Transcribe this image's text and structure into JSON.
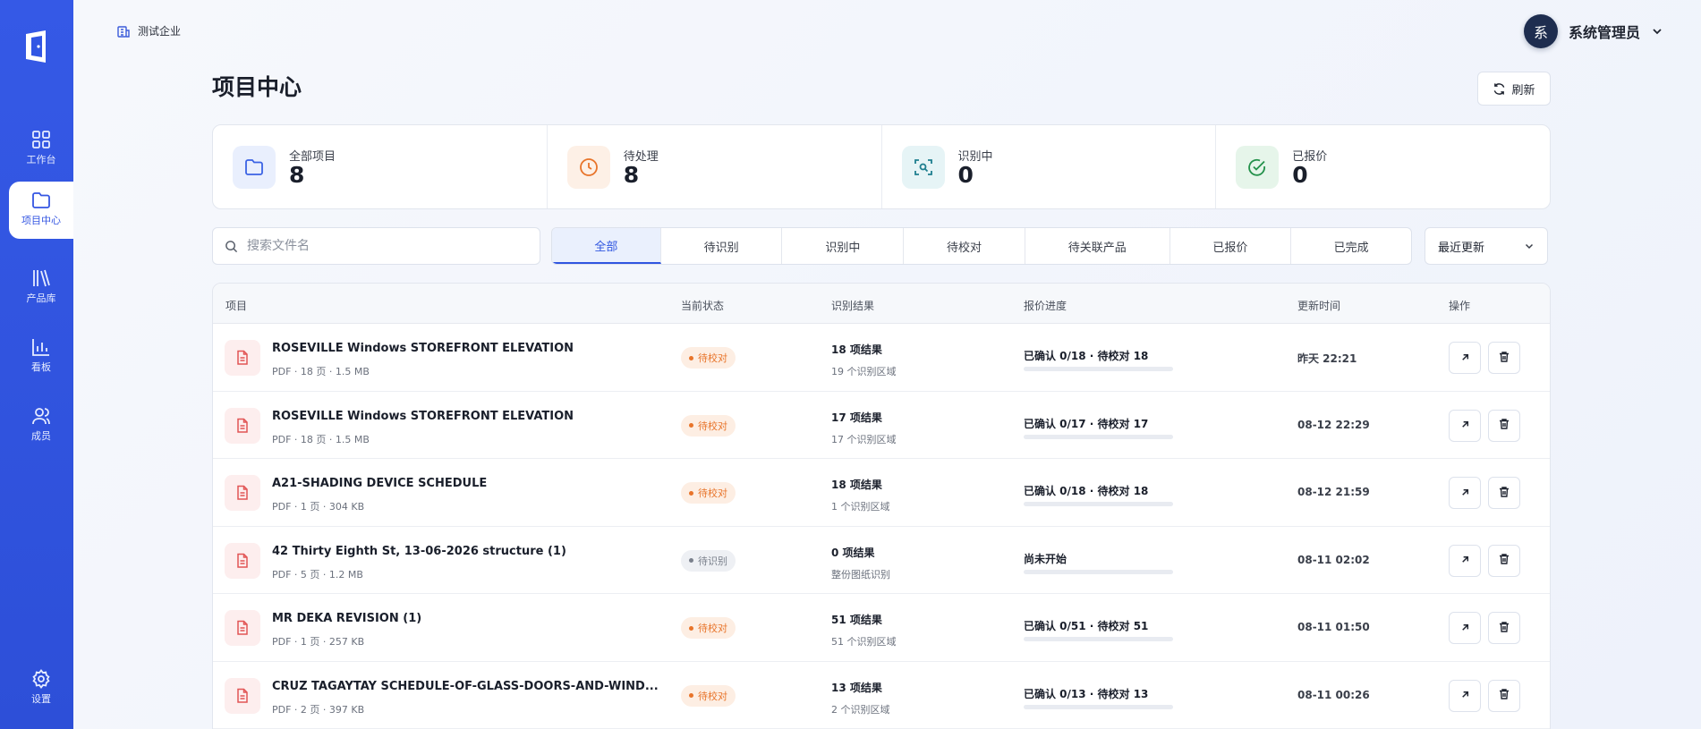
{
  "colors": {
    "sidebar": "#3156e4",
    "accent": "#2f55e0",
    "pending_review": "#e8742a",
    "pending_recognize": "#7a808c"
  },
  "sidebar": {
    "logo": "door-logo-icon",
    "items": [
      {
        "label": "工作台",
        "icon": "grid-icon"
      },
      {
        "label": "项目中心",
        "icon": "folder-icon",
        "active": true
      },
      {
        "label": "产品库",
        "icon": "books-icon"
      },
      {
        "label": "看板",
        "icon": "chart-icon"
      },
      {
        "label": "成员",
        "icon": "users-icon"
      },
      {
        "label": "设置",
        "icon": "gear-icon"
      }
    ]
  },
  "header": {
    "company": "测试企业",
    "user_avatar": "系",
    "user_name": "系统管理员"
  },
  "page": {
    "title": "项目中心",
    "refresh_label": "刷新"
  },
  "stats": [
    {
      "label": "全部项目",
      "value": "8"
    },
    {
      "label": "待处理",
      "value": "8"
    },
    {
      "label": "识别中",
      "value": "0"
    },
    {
      "label": "已报价",
      "value": "0"
    }
  ],
  "search": {
    "placeholder": "搜索文件名",
    "value": ""
  },
  "tabs": [
    "全部",
    "待识别",
    "识别中",
    "待校对",
    "待关联产品",
    "已报价",
    "已完成"
  ],
  "active_tab": "全部",
  "sort": {
    "selected": "最近更新"
  },
  "table": {
    "headers": {
      "project": "项目",
      "status": "当前状态",
      "result": "识别结果",
      "progress": "报价进度",
      "updated": "更新时间",
      "actions": "操作"
    },
    "rows": [
      {
        "name": "ROSEVILLE Windows STOREFRONT ELEVATION",
        "meta": "PDF · 18 页 · 1.5 MB",
        "status": "待校对",
        "result": "18 项结果",
        "result_sub": "19 个识别区域",
        "progress_text": "已确认 0/18 · 待校对 18",
        "progress": 0,
        "updated": "昨天 22:21"
      },
      {
        "name": "ROSEVILLE Windows STOREFRONT ELEVATION",
        "meta": "PDF · 18 页 · 1.5 MB",
        "status": "待校对",
        "result": "17 项结果",
        "result_sub": "17 个识别区域",
        "progress_text": "已确认 0/17 · 待校对 17",
        "progress": 0,
        "updated": "08-12 22:29"
      },
      {
        "name": "A21-SHADING DEVICE SCHEDULE",
        "meta": "PDF · 1 页 · 304 KB",
        "status": "待校对",
        "result": "18 项结果",
        "result_sub": "1 个识别区域",
        "progress_text": "已确认 0/18 · 待校对 18",
        "progress": 0,
        "updated": "08-12 21:59"
      },
      {
        "name": "42 Thirty Eighth St, 13-06-2026 structure (1)",
        "meta": "PDF · 5 页 · 1.2 MB",
        "status": "待识别",
        "result": "0 项结果",
        "result_sub": "整份图纸识别",
        "progress_text": "尚未开始",
        "progress": 0,
        "updated": "08-11 02:02"
      },
      {
        "name": "MR DEKA REVISION (1)",
        "meta": "PDF · 1 页 · 257 KB",
        "status": "待校对",
        "result": "51 项结果",
        "result_sub": "51 个识别区域",
        "progress_text": "已确认 0/51 · 待校对 51",
        "progress": 0,
        "updated": "08-11 01:50"
      },
      {
        "name": "CRUZ TAGAYTAY SCHEDULE-OF-GLASS-DOORS-AND-WIND...",
        "meta": "PDF · 2 页 · 397 KB",
        "status": "待校对",
        "result": "13 项结果",
        "result_sub": "2 个识别区域",
        "progress_text": "已确认 0/13 · 待校对 13",
        "progress": 0,
        "updated": "08-11 00:26"
      }
    ]
  }
}
